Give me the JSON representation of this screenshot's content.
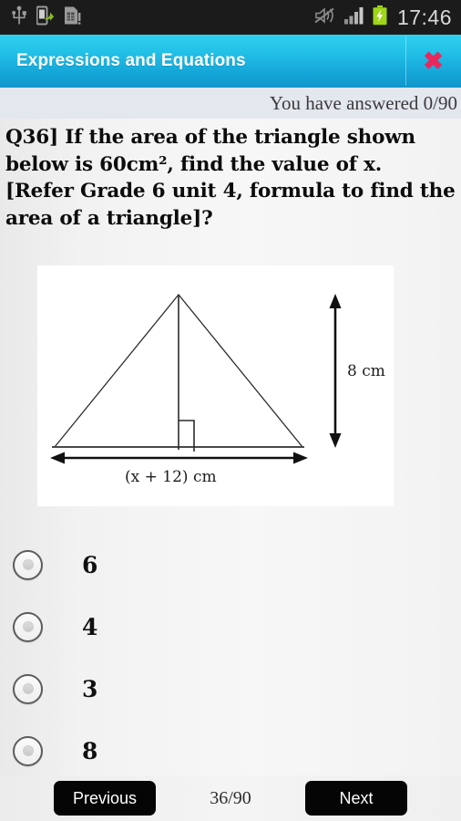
{
  "status_bar": {
    "icons": [
      "usb-icon",
      "phone-transfer-icon",
      "sim-card-alert-icon"
    ],
    "right_icons": [
      "mute-icon",
      "signal-bars-icon",
      "battery-charging-icon"
    ],
    "clock": "17:46"
  },
  "header": {
    "title": "Expressions and Equations",
    "close_label": "✖",
    "background_color": "#24c2e8",
    "close_color": "#e8275c"
  },
  "progress": {
    "answered_text": "You have answered 0/90"
  },
  "question": {
    "text": "Q36]   If the area of the triangle shown below is 60cm², find the value of x. [Refer Grade 6 unit 4, formula to find the area of a triangle]?"
  },
  "figure": {
    "base_label": "(x + 12) cm",
    "height_label": "8 cm"
  },
  "options": [
    {
      "label": "6",
      "selected": false
    },
    {
      "label": "4",
      "selected": false
    },
    {
      "label": "3",
      "selected": false
    },
    {
      "label": "8",
      "selected": false
    }
  ],
  "footer": {
    "previous_label": "Previous",
    "next_label": "Next",
    "page_counter": "36/90"
  }
}
